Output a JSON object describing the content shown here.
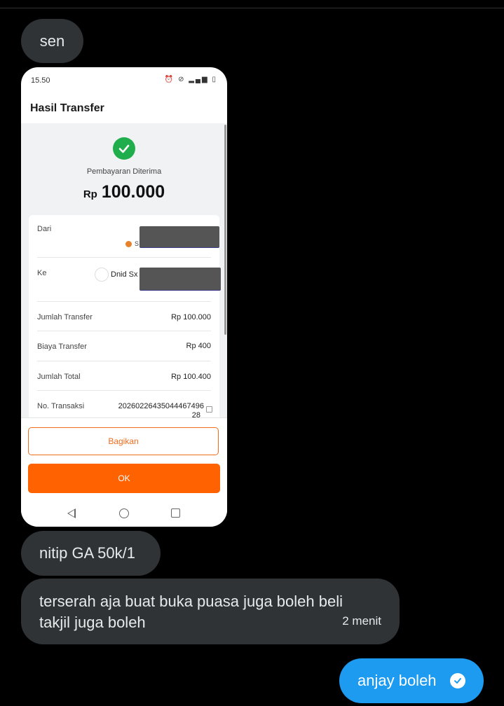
{
  "messages": {
    "m1": "sen",
    "m2": "nitip GA 50k/1",
    "m3": "terserah aja buat buka puasa juga boleh beli takjil juga boleh",
    "m3_time": "2 menit",
    "m4": "anjay boleh"
  },
  "screenshot": {
    "status_time": "15.50",
    "title": "Hasil Transfer",
    "status_label": "Pembayaran Diterima",
    "currency": "Rp",
    "amount": "100.000",
    "rows": {
      "dari_label": "Dari",
      "dari_fragment": "S",
      "ke_label": "Ke",
      "ke_value": "Dnid Sx",
      "jumlah_transfer_label": "Jumlah Transfer",
      "jumlah_transfer_value": "Rp 100.000",
      "biaya_label": "Biaya Transfer",
      "biaya_value": "Rp 400",
      "total_label": "Jumlah Total",
      "total_value": "Rp 100.400",
      "trx_label": "No. Transaksi",
      "trx_value_line1": "20260226435044467496",
      "trx_value_line2": "28"
    },
    "share_button": "Bagikan",
    "ok_button": "OK"
  },
  "colors": {
    "incoming_bubble": "#2f3336",
    "outgoing_bubble": "#1d9bf0",
    "success": "#1fae4b",
    "accent_orange": "#ff6200"
  }
}
